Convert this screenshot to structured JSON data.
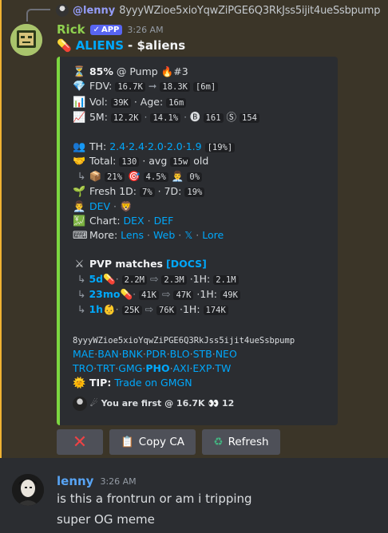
{
  "reply": {
    "name": "@lenny",
    "text": "8yyyWZioe5xioYqwZiPGE6Q3RkJss5ijit4ueSsbpump"
  },
  "bot": {
    "author": "Rick",
    "tag": "APP",
    "time": "3:26 AM",
    "headline_icon": "pill-icon",
    "coin": "ALIENS",
    "ticker": "- $aliens"
  },
  "embed": {
    "accent": "#7cd640",
    "stats": {
      "pct": "85%",
      "venue": "@ Pump",
      "rank": "#3",
      "fdv_label": "FDV:",
      "fdv_from": "16.7K",
      "fdv_to": "18.3K",
      "fdv_time": "[6m]",
      "vol_label": "Vol:",
      "vol": "39K",
      "age_label": "· Age:",
      "age": "16m",
      "m5_label": "5M:",
      "m5_val": "12.2K",
      "m5_pct": "14.1%",
      "m5_b": "161",
      "m5_s": "154"
    },
    "holders": {
      "th_label": "TH:",
      "th_values": [
        "2.4",
        "2.4",
        "2.0",
        "2.0",
        "1.9"
      ],
      "th_total": "[19%]",
      "total_label": "Total:",
      "total": "130",
      "avg_label": "· avg",
      "avg": "15w",
      "old": "old",
      "p1": "21%",
      "p2": "4.5%",
      "p3": "0%",
      "fresh_label": "Fresh 1D:",
      "fresh_1d": "7%",
      "fresh_7d_label": "· 7D:",
      "fresh_7d": "19%",
      "dev": "DEV",
      "chart_label": "Chart:",
      "chart_links": [
        "DEX",
        "DEF"
      ],
      "more_label": "More:",
      "more_links": [
        "Lens",
        "Web",
        "𝕏",
        "Lore"
      ]
    },
    "pvp": {
      "title": "PVP matches",
      "docs": "[DOCS]",
      "rows": [
        {
          "age": "5d",
          "from": "2.2M",
          "to": "2.3M",
          "h_label": "·1H:",
          "h": "2.1M",
          "icon": "pill-icon"
        },
        {
          "age": "23mo",
          "from": "41K",
          "to": "47K",
          "h_label": "·1H:",
          "h": "49K",
          "icon": "pill-icon"
        },
        {
          "age": "1h",
          "from": "25K",
          "to": "76K",
          "h_label": "·1H:",
          "h": "174K",
          "icon": "baby-face-icon"
        }
      ]
    },
    "ca": "8yyyWZioe5xioYqwZiPGE6Q3RkJss5ijit4ueSsbpump",
    "links_row1": [
      "MAE",
      "BAN",
      "BNK",
      "PDR",
      "BLO",
      "STB",
      "NEO"
    ],
    "links_row2": [
      "TRO",
      "TRT",
      "GMG",
      "PHO",
      "AXI",
      "EXP",
      "TW"
    ],
    "tip_label": "TIP:",
    "tip_text": "Trade on GMGN",
    "footer": "You are first @ 16.7K",
    "footer_count": "12"
  },
  "buttons": {
    "close": "✕",
    "copy": "Copy CA",
    "refresh": "Refresh"
  },
  "reply_msg": {
    "author": "lenny",
    "time": "3:26 AM",
    "line1": "is this a frontrun or am i tripping",
    "line2": "super OG meme"
  }
}
